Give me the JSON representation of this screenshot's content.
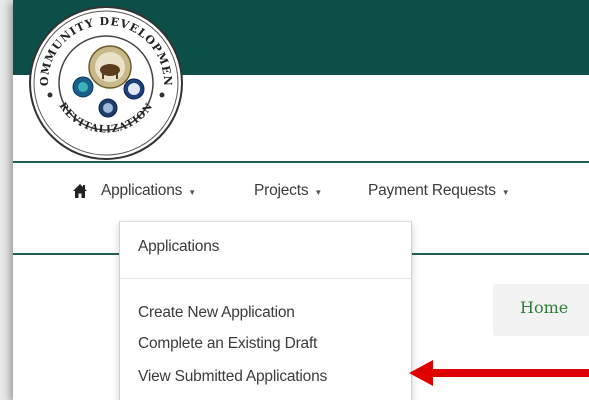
{
  "logo": {
    "top_text": "COMMUNITY DEVELOPMENT",
    "bottom_text": "REVITALIZATION"
  },
  "nav": {
    "home_icon": "home-icon",
    "items": [
      {
        "label": "Applications"
      },
      {
        "label": "Projects"
      },
      {
        "label": "Payment Requests"
      }
    ]
  },
  "dropdown": {
    "header": "Applications",
    "items": [
      {
        "label": "Create New Application"
      },
      {
        "label": "Complete an Existing Draft"
      },
      {
        "label": "View Submitted Applications"
      }
    ]
  },
  "breadcrumb": {
    "home_label": "Home"
  },
  "colors": {
    "header_bar": "#0c4f48",
    "divider": "#1f5d55",
    "breadcrumb_text": "#2f7d3b",
    "arrow": "#e00000"
  }
}
